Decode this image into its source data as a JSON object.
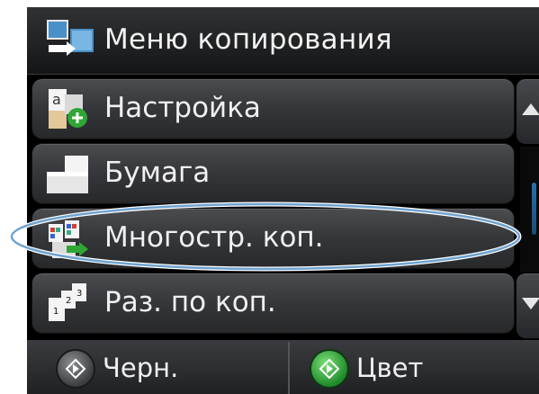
{
  "header": {
    "title": "Меню копирования",
    "icon": "copy-menu-icon"
  },
  "menu": {
    "items": [
      {
        "label": "Настройка",
        "icon": "settings-copy-icon"
      },
      {
        "label": "Бумага",
        "icon": "paper-icon"
      },
      {
        "label": "Многостр. коп.",
        "icon": "multipage-copy-icon"
      },
      {
        "label": "Раз. по коп.",
        "icon": "collate-icon"
      }
    ],
    "highlighted_item": "Многостр. коп."
  },
  "scroll": {
    "up_icon": "scroll-up-arrow-icon",
    "down_icon": "scroll-down-arrow-icon"
  },
  "footer": {
    "bw_label": "Черн.",
    "color_label": "Цвет"
  },
  "colors": {
    "start_color": "#2fa636",
    "start_bw": "#5c5e61",
    "highlight_ring": "#6fa3cf",
    "scroll_thumb": "#2a6fa8"
  }
}
